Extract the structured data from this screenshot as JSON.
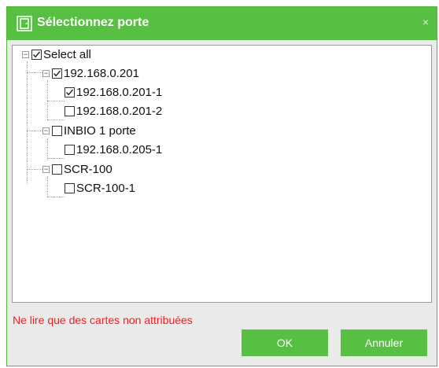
{
  "dialog": {
    "title": "Sélectionnez porte",
    "close_glyph": "×",
    "note": "Ne lire que des cartes non attribuées",
    "ok_label": "OK",
    "cancel_label": "Annuler",
    "accent_color": "#57bf41",
    "note_color": "#ff1a1a"
  },
  "tree": {
    "root": {
      "label": "Select all",
      "checked": true,
      "expanded": true
    },
    "g1": {
      "label": "192.168.0.201",
      "checked": true,
      "expanded": true
    },
    "g1c1": {
      "label": "192.168.0.201-1",
      "checked": true
    },
    "g1c2": {
      "label": "192.168.0.201-2",
      "checked": false
    },
    "g2": {
      "label": "INBIO 1 porte",
      "checked": false,
      "expanded": true
    },
    "g2c1": {
      "label": "192.168.0.205-1",
      "checked": false
    },
    "g3": {
      "label": "SCR-100",
      "checked": false,
      "expanded": true
    },
    "g3c1": {
      "label": "SCR-100-1",
      "checked": false
    }
  },
  "icons": {
    "title": "door-icon",
    "expander": "minus-box-icon",
    "check": "checkmark-icon"
  }
}
